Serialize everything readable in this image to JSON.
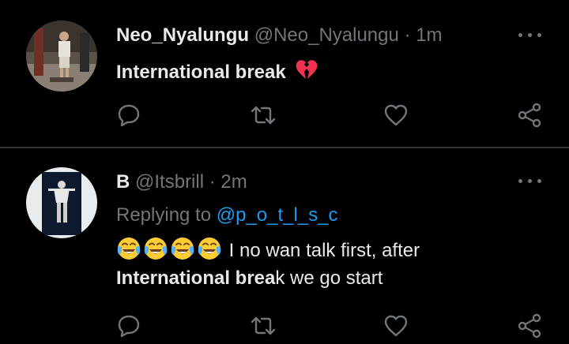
{
  "tweet1": {
    "display_name": "Neo_Nyalungu",
    "handle": "@Neo_Nyalungu",
    "separator": "·",
    "time": "1m",
    "text": "International break",
    "emoji": "broken-heart-icon"
  },
  "tweet2": {
    "display_name": "B",
    "handle": "@Itsbrill",
    "separator": "·",
    "time": "2m",
    "replying_label": "Replying to",
    "replying_mention": "@p_o_t_l_s_c",
    "text_line1": "I no wan talk first, after",
    "text_line2_bold": "International brea",
    "text_line2_rest": "k we go start",
    "emoji": "face-with-tears-of-joy-icon",
    "emoji_count": 4
  },
  "colors": {
    "background": "#000000",
    "text": "#e7e9ea",
    "muted": "#71767b",
    "mention": "#1d9bf0",
    "divider": "#2f3336",
    "broken_heart": "#f0324e"
  }
}
